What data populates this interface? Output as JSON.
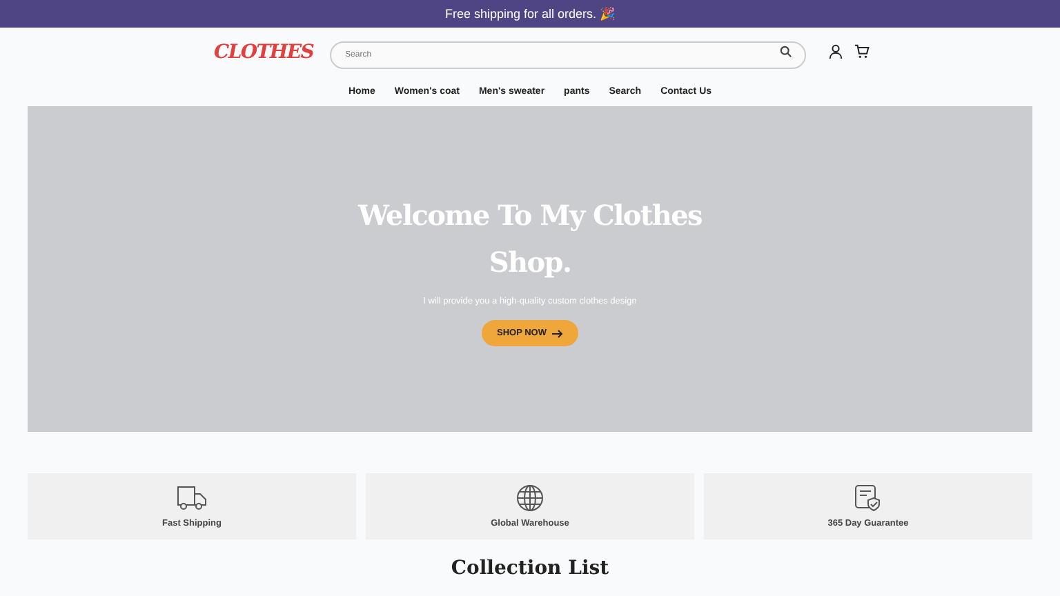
{
  "announcement": "Free shipping for all orders. 🎉",
  "header": {
    "logo": "CLOTHES",
    "search": {
      "placeholder": "Search"
    }
  },
  "nav": [
    "Home",
    "Women's coat",
    "Men's sweater",
    "pants",
    "Search",
    "Contact Us"
  ],
  "hero": {
    "title": "Welcome To My Clothes Shop.",
    "subtitle": "I will provide you a high-quality custom clothes design",
    "button": "SHOP NOW"
  },
  "features": [
    {
      "kind": "truck",
      "label": "Fast Shipping"
    },
    {
      "kind": "globe",
      "label": "Global Warehouse"
    },
    {
      "kind": "guarantee",
      "label": "365 Day Guarantee"
    }
  ],
  "section_heading": "Collection List"
}
